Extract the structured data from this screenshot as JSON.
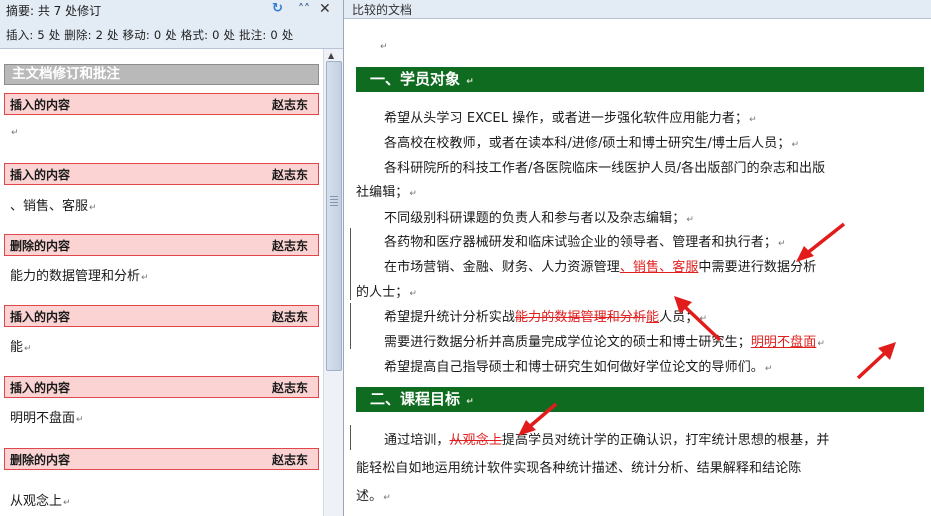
{
  "review_pane": {
    "title": "摘要: 共 7 处修订",
    "stats": "插入: 5 处  删除: 2 处  移动: 0 处  格式: 0 处  批注: 0 处",
    "section_title": "主文档修订和批注",
    "revisions": [
      {
        "kind": "插入的内容",
        "author": "赵志东",
        "text": ""
      },
      {
        "kind": "插入的内容",
        "author": "赵志东",
        "text": "、销售、客服"
      },
      {
        "kind": "删除的内容",
        "author": "赵志东",
        "text": "能力的数据管理和分析"
      },
      {
        "kind": "插入的内容",
        "author": "赵志东",
        "text": "能"
      },
      {
        "kind": "插入的内容",
        "author": "赵志东",
        "text": "明明不盘面"
      },
      {
        "kind": "删除的内容",
        "author": "赵志东",
        "text": "从观念上"
      }
    ]
  },
  "document": {
    "title": "比较的文档",
    "heading1": "一、学员对象",
    "heading2": "二、课程目标",
    "lines": {
      "l1": "希望从头学习 EXCEL 操作，或者进一步强化软件应用能力者；",
      "l2": "各高校在校教师，或者在读本科/进修/硕士和博士研究生/博士后人员；",
      "l3": "各科研院所的科技工作者/各医院临床一线医护人员/各出版部门的杂志和出版",
      "l3b": "社编辑；",
      "l4": "不同级别科研课题的负责人和参与者以及杂志编辑；",
      "l5": "各药物和医疗器械研发和临床试验企业的领导者、管理者和执行者；",
      "l6a": "在市场营销、金融、财务、人力资源管理",
      "l6ins": "、销售、客服",
      "l6b": "中需要进行数据分析",
      "l6c": "的人士；",
      "l7a": "希望提升统计分析实战",
      "l7del": "能力的数据管理和分析",
      "l7ins": "能",
      "l7b": "人员；",
      "l8a": "需要进行数据分析并高质量完成学位论文的硕士和博士研究生；",
      "l8ins": "明明不盘面",
      "l9": "希望提高自己指导硕士和博士研究生如何做好学位论文的导师们。",
      "p2a": "通过培训，",
      "p2del": "从观念上",
      "p2b": "提高学员对统计学的正确认识，打牢统计思想的根基，并",
      "p2c": "能轻松自如地运用统计软件实现各种统计描述、统计分析、结果解释和结论陈",
      "p2d": "述。"
    }
  },
  "colors": {
    "heading_bg": "#0f6b20",
    "revision_red": "#e02020",
    "revision_box_bg": "#fbd3d3",
    "pane_header_bg": "#e3ebf5"
  }
}
